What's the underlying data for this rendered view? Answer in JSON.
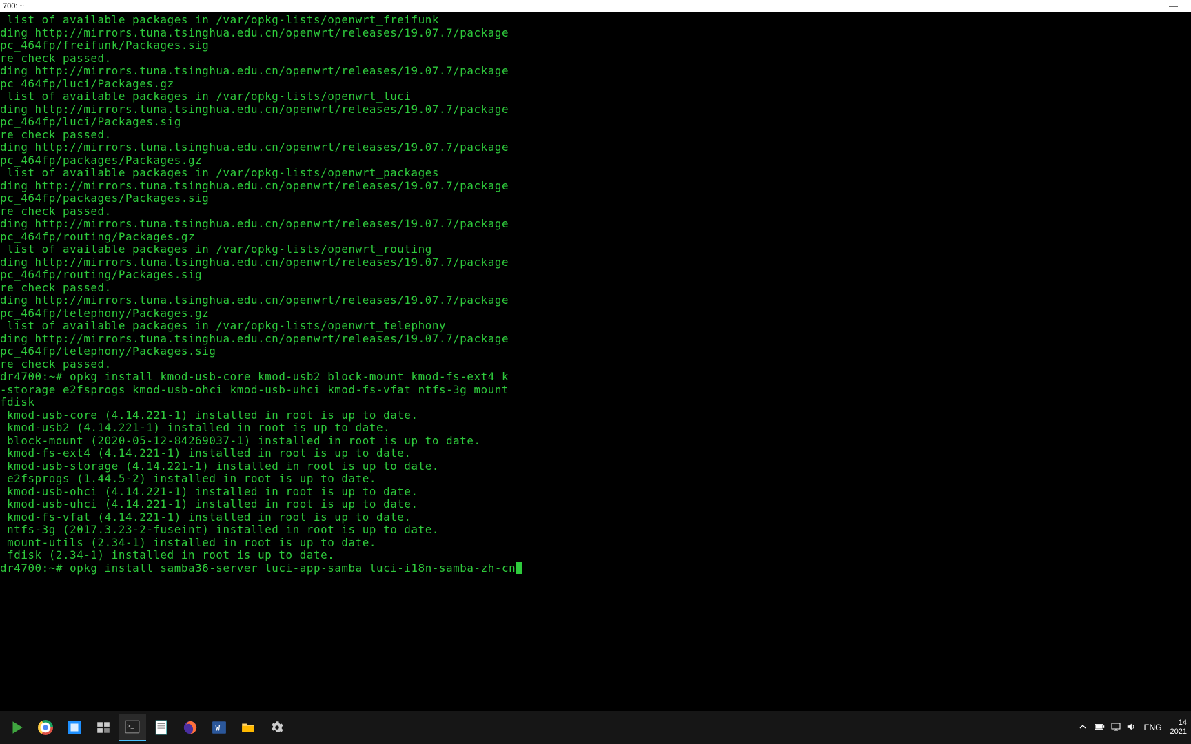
{
  "title_bar": {
    "title": "700: ~",
    "minimize": "—"
  },
  "terminal": {
    "lines": [
      " list of available packages in /var/opkg-lists/openwrt_freifunk",
      "ding http://mirrors.tuna.tsinghua.edu.cn/openwrt/releases/19.07.7/package",
      "pc_464fp/freifunk/Packages.sig",
      "re check passed.",
      "ding http://mirrors.tuna.tsinghua.edu.cn/openwrt/releases/19.07.7/package",
      "pc_464fp/luci/Packages.gz",
      " list of available packages in /var/opkg-lists/openwrt_luci",
      "ding http://mirrors.tuna.tsinghua.edu.cn/openwrt/releases/19.07.7/package",
      "pc_464fp/luci/Packages.sig",
      "re check passed.",
      "ding http://mirrors.tuna.tsinghua.edu.cn/openwrt/releases/19.07.7/package",
      "pc_464fp/packages/Packages.gz",
      " list of available packages in /var/opkg-lists/openwrt_packages",
      "ding http://mirrors.tuna.tsinghua.edu.cn/openwrt/releases/19.07.7/package",
      "pc_464fp/packages/Packages.sig",
      "re check passed.",
      "ding http://mirrors.tuna.tsinghua.edu.cn/openwrt/releases/19.07.7/package",
      "pc_464fp/routing/Packages.gz",
      " list of available packages in /var/opkg-lists/openwrt_routing",
      "ding http://mirrors.tuna.tsinghua.edu.cn/openwrt/releases/19.07.7/package",
      "pc_464fp/routing/Packages.sig",
      "re check passed.",
      "ding http://mirrors.tuna.tsinghua.edu.cn/openwrt/releases/19.07.7/package",
      "pc_464fp/telephony/Packages.gz",
      " list of available packages in /var/opkg-lists/openwrt_telephony",
      "ding http://mirrors.tuna.tsinghua.edu.cn/openwrt/releases/19.07.7/package",
      "pc_464fp/telephony/Packages.sig",
      "re check passed.",
      "dr4700:~# opkg install kmod-usb-core kmod-usb2 block-mount kmod-fs-ext4 k",
      "-storage e2fsprogs kmod-usb-ohci kmod-usb-uhci kmod-fs-vfat ntfs-3g mount",
      "fdisk",
      " kmod-usb-core (4.14.221-1) installed in root is up to date.",
      " kmod-usb2 (4.14.221-1) installed in root is up to date.",
      " block-mount (2020-05-12-84269037-1) installed in root is up to date.",
      " kmod-fs-ext4 (4.14.221-1) installed in root is up to date.",
      " kmod-usb-storage (4.14.221-1) installed in root is up to date.",
      " e2fsprogs (1.44.5-2) installed in root is up to date.",
      " kmod-usb-ohci (4.14.221-1) installed in root is up to date.",
      " kmod-usb-uhci (4.14.221-1) installed in root is up to date.",
      " kmod-fs-vfat (4.14.221-1) installed in root is up to date.",
      " ntfs-3g (2017.3.23-2-fuseint) installed in root is up to date.",
      " mount-utils (2.34-1) installed in root is up to date.",
      " fdisk (2.34-1) installed in root is up to date."
    ],
    "prompt_line": "dr4700:~# opkg install samba36-server luci-app-samba luci-i18n-samba-zh-cn"
  },
  "taskbar": {
    "ime": "ENG",
    "time": "14",
    "date": "2021"
  }
}
